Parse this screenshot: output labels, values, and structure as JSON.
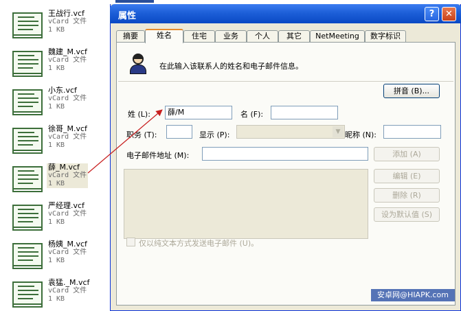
{
  "files": [
    {
      "name": "王战行.vcf",
      "type": "vCard 文件",
      "size": "1 KB"
    },
    {
      "name": "魏建_M.vcf",
      "type": "vCard 文件",
      "size": "1 KB"
    },
    {
      "name": "小东.vcf",
      "type": "vCard 文件",
      "size": "1 KB"
    },
    {
      "name": "徐哥_M.vcf",
      "type": "vCard 文件",
      "size": "1 KB"
    },
    {
      "name": "薛_M.vcf",
      "type": "vCard 文件",
      "size": "1 KB"
    },
    {
      "name": "严经理.vcf",
      "type": "vCard 文件",
      "size": "1 KB"
    },
    {
      "name": "杨姨_M.vcf",
      "type": "vCard 文件",
      "size": "1 KB"
    },
    {
      "name": "袁猛._M.vcf",
      "type": "vCard 文件",
      "size": "1 KB"
    }
  ],
  "dialog": {
    "title": "属性",
    "help_glyph": "?",
    "close_glyph": "✕",
    "tabs": [
      "摘要",
      "姓名",
      "住宅",
      "业务",
      "个人",
      "其它",
      "NetMeeting",
      "数字标识"
    ],
    "active_tab": "姓名",
    "intro": "在此输入该联系人的姓名和电子邮件信息。",
    "pinyin_button": "拼音 (B)...",
    "labels": {
      "surname": "姓 (L):",
      "given": "名 (F):",
      "title": "职务 (T):",
      "display": "显示 (P):",
      "nickname": "昵称 (N):",
      "email": "电子邮件地址 (M):"
    },
    "values": {
      "surname": "薛/M",
      "given": "",
      "title": "",
      "display": "",
      "nickname": "",
      "email": ""
    },
    "buttons": {
      "add": "添加 (A)",
      "edit": "编辑 (E)",
      "remove": "删除 (R)",
      "set_default": "设为默认值 (S)"
    },
    "plain_text_checkbox": "仅以纯文本方式发送电子邮件 (U)。"
  },
  "watermark": "安卓网@HIAPK.com",
  "colors": {
    "titlebar": "#0a49c4",
    "arrow": "#c81e1e",
    "vcf_icon": "#3c6e3a"
  }
}
